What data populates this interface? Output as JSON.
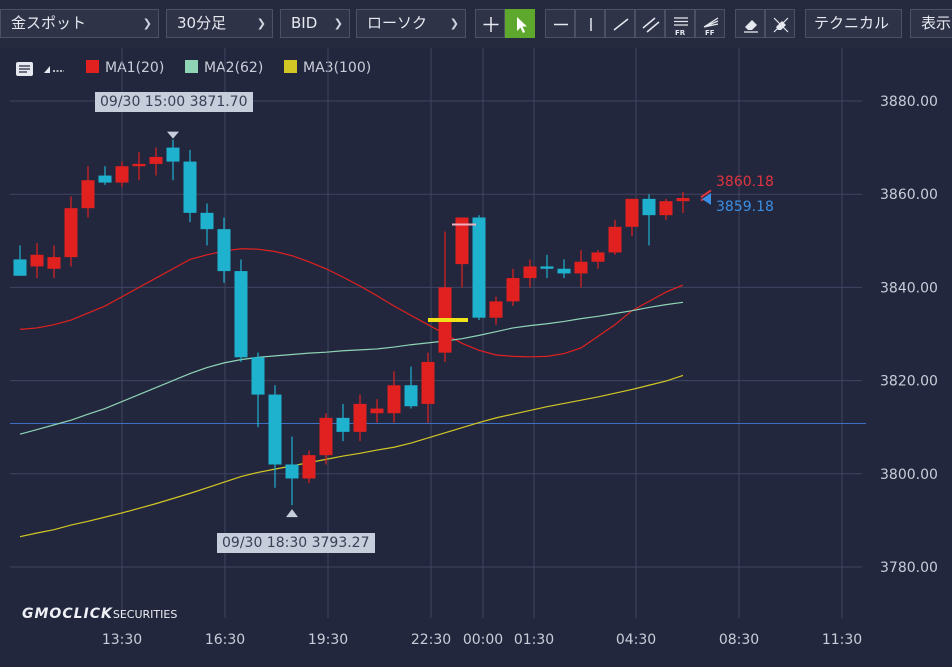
{
  "toolbar": {
    "symbol": "金スポット",
    "timeframe": "30分足",
    "price_type": "BID",
    "chart_style": "ローソク",
    "technical": "テクニカル",
    "display": "表示",
    "tools": [
      "crosshair-icon",
      "pointer-icon",
      "hline-icon",
      "vline-icon",
      "trendline-icon",
      "channel-icon",
      "fibonacci-retracement-icon",
      "fibonacci-fan-icon",
      "eraser-icon",
      "erase-all-icon"
    ]
  },
  "legend": {
    "ma1": {
      "label": "MA1(20)",
      "color": "#e0211f"
    },
    "ma2": {
      "label": "MA2(62)",
      "color": "#8ed4b5"
    },
    "ma3": {
      "label": "MA3(100)",
      "color": "#d2c724"
    }
  },
  "tooltips": {
    "high": "09/30 15:00 3871.70",
    "low": "09/30 18:30 3793.27"
  },
  "price_labels": {
    "ask": "3860.18",
    "bid": "3859.18",
    "ask_color": "#e0353f",
    "bid_color": "#3b8fe3"
  },
  "watermark": {
    "brand": "GMOCLICK",
    "suffix": "SECURITIES"
  },
  "chart_data": {
    "type": "candlestick",
    "y_ticks": [
      "3880.00",
      "3860.00",
      "3840.00",
      "3820.00",
      "3800.00",
      "3780.00"
    ],
    "x_ticks": [
      "13:30",
      "16:30",
      "19:30",
      "22:30",
      "00:00",
      "01:30",
      "04:30",
      "08:30",
      "11:30"
    ],
    "ylim": [
      3775,
      3890
    ],
    "grid": true,
    "colors": {
      "up": "#e0211f",
      "down": "#1fb2cf"
    },
    "candles": [
      [
        3846.0,
        3849.0,
        3842.5,
        3842.5
      ],
      [
        3844.5,
        3849.5,
        3842.0,
        3847.0
      ],
      [
        3844.0,
        3849.0,
        3842.0,
        3846.5
      ],
      [
        3846.5,
        3859.5,
        3844.5,
        3857.0
      ],
      [
        3857.0,
        3866.0,
        3855.0,
        3863.0
      ],
      [
        3864.0,
        3866.0,
        3862.0,
        3862.5
      ],
      [
        3862.5,
        3867.0,
        3861.5,
        3866.0
      ],
      [
        3866.0,
        3869.0,
        3863.0,
        3866.5
      ],
      [
        3866.5,
        3870.0,
        3864.0,
        3868.0
      ],
      [
        3870.0,
        3871.7,
        3863.0,
        3867.0
      ],
      [
        3867.0,
        3869.5,
        3854.0,
        3856.0
      ],
      [
        3856.0,
        3858.0,
        3849.0,
        3852.5
      ],
      [
        3852.5,
        3855.0,
        3841.0,
        3843.5
      ],
      [
        3843.5,
        3846.0,
        3824.0,
        3825.0
      ],
      [
        3825.0,
        3826.0,
        3810.0,
        3817.0
      ],
      [
        3817.0,
        3819.0,
        3797.0,
        3802.0
      ],
      [
        3802.0,
        3808.0,
        3793.27,
        3799.0
      ],
      [
        3799.0,
        3805.0,
        3798.0,
        3804.0
      ],
      [
        3804.0,
        3813.0,
        3802.0,
        3812.0
      ],
      [
        3812.0,
        3815.0,
        3807.0,
        3809.0
      ],
      [
        3809.0,
        3817.0,
        3807.0,
        3815.0
      ],
      [
        3813.0,
        3816.0,
        3811.0,
        3814.0
      ],
      [
        3813.0,
        3822.0,
        3811.0,
        3819.0
      ],
      [
        3819.0,
        3823.0,
        3814.0,
        3814.5
      ],
      [
        3815.0,
        3826.0,
        3811.0,
        3824.0
      ],
      [
        3826.0,
        3852.0,
        3824.0,
        3840.0
      ],
      [
        3845.0,
        3855.0,
        3840.0,
        3855.0
      ],
      [
        3855.0,
        3855.5,
        3833.0,
        3833.5
      ],
      [
        3833.5,
        3838.0,
        3832.0,
        3837.0
      ],
      [
        3837.0,
        3844.0,
        3836.0,
        3842.0
      ],
      [
        3842.0,
        3846.0,
        3840.0,
        3844.5
      ],
      [
        3844.5,
        3847.0,
        3842.0,
        3844.0
      ],
      [
        3844.0,
        3846.0,
        3842.0,
        3843.0
      ],
      [
        3843.0,
        3848.0,
        3840.0,
        3845.5
      ],
      [
        3845.5,
        3848.0,
        3844.0,
        3847.5
      ],
      [
        3847.5,
        3854.5,
        3847.0,
        3853.0
      ],
      [
        3853.0,
        3859.0,
        3851.0,
        3859.0
      ],
      [
        3859.0,
        3860.0,
        3849.0,
        3855.5
      ],
      [
        3855.5,
        3859.0,
        3854.5,
        3858.5
      ],
      [
        3858.5,
        3860.5,
        3856.0,
        3859.18
      ]
    ],
    "series": [
      {
        "name": "MA1(20)",
        "color": "#e0211f",
        "values": [
          3831,
          3831.3,
          3832,
          3833,
          3834.5,
          3836,
          3838,
          3840,
          3842,
          3844,
          3846,
          3847,
          3847.8,
          3848.3,
          3848.2,
          3847.7,
          3846.8,
          3845.5,
          3844,
          3842.2,
          3840.3,
          3838.2,
          3836,
          3834,
          3832,
          3830,
          3828,
          3826.5,
          3825.5,
          3825.2,
          3825.1,
          3825.2,
          3825.8,
          3827,
          3829.5,
          3832,
          3835,
          3837,
          3839,
          3840.5
        ]
      },
      {
        "name": "MA2(62)",
        "color": "#8ed4b5",
        "values": [
          3808.5,
          3809.5,
          3810.5,
          3811.5,
          3812.8,
          3814,
          3815.5,
          3817,
          3818.5,
          3820,
          3821.5,
          3822.8,
          3823.8,
          3824.5,
          3825,
          3825.3,
          3825.6,
          3825.9,
          3826.1,
          3826.4,
          3826.6,
          3826.8,
          3827.2,
          3827.7,
          3828.1,
          3828.5,
          3829,
          3829.7,
          3830.5,
          3831.3,
          3831.8,
          3832.2,
          3832.7,
          3833.3,
          3833.8,
          3834.4,
          3835,
          3835.7,
          3836.3,
          3836.8
        ]
      },
      {
        "name": "MA3(100)",
        "color": "#d2c724",
        "values": [
          3786.5,
          3787.3,
          3788,
          3789,
          3789.8,
          3790.7,
          3791.6,
          3792.6,
          3793.6,
          3794.7,
          3795.8,
          3797,
          3798.2,
          3799.4,
          3800.3,
          3801,
          3801.7,
          3802.4,
          3803.1,
          3803.8,
          3804.4,
          3805.1,
          3805.7,
          3806.6,
          3807.7,
          3808.8,
          3809.9,
          3811,
          3812,
          3812.8,
          3813.6,
          3814.4,
          3815.1,
          3815.8,
          3816.5,
          3817.3,
          3818.1,
          3819,
          3819.9,
          3821.1
        ]
      }
    ],
    "reference_price": 3810.8,
    "high_marker": {
      "label": "09/30 15:00 3871.70",
      "candle": 9,
      "price": 3871.7
    },
    "low_marker": {
      "label": "09/30 18:30 3793.27",
      "candle": 16,
      "price": 3793.27
    }
  }
}
